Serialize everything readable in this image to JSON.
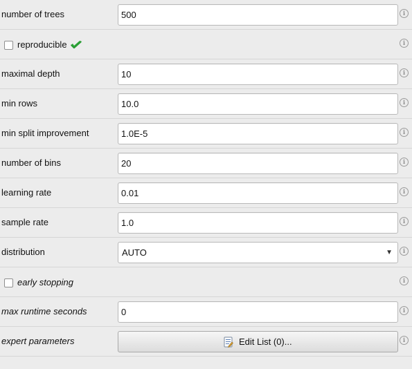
{
  "params": {
    "number_of_trees": {
      "label": "number of trees",
      "value": "500"
    },
    "reproducible": {
      "label": "reproducible",
      "checked": false
    },
    "maximal_depth": {
      "label": "maximal depth",
      "value": "10"
    },
    "min_rows": {
      "label": "min rows",
      "value": "10.0"
    },
    "min_split_improvement": {
      "label": "min split improvement",
      "value": "1.0E-5"
    },
    "number_of_bins": {
      "label": "number of bins",
      "value": "20"
    },
    "learning_rate": {
      "label": "learning rate",
      "value": "0.01"
    },
    "sample_rate": {
      "label": "sample rate",
      "value": "1.0"
    },
    "distribution": {
      "label": "distribution",
      "value": "AUTO"
    },
    "early_stopping": {
      "label": "early stopping",
      "checked": false
    },
    "max_runtime_seconds": {
      "label": "max runtime seconds",
      "value": "0"
    },
    "expert_parameters": {
      "label": "expert parameters",
      "button_label": "Edit List (0)..."
    }
  },
  "icons": {
    "info": "info-icon",
    "check": "green-checkmark-icon",
    "list": "edit-list-icon"
  },
  "colors": {
    "background": "#ececec",
    "check_green": "#2fa83a"
  }
}
